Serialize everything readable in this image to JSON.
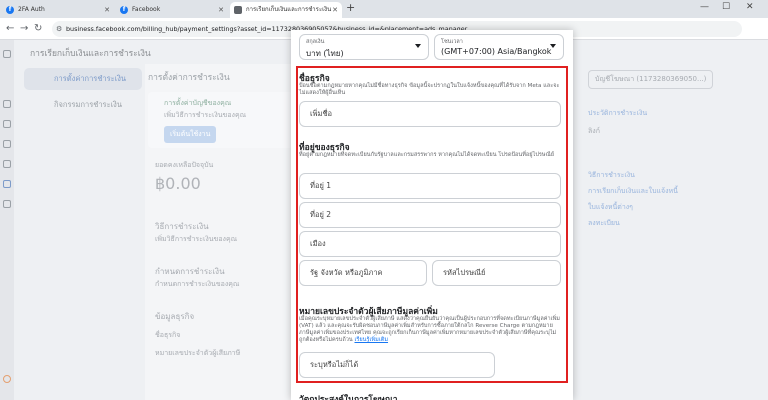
{
  "browser": {
    "tabs": [
      {
        "title": "2FA Auth",
        "active": false
      },
      {
        "title": "Facebook",
        "active": false
      },
      {
        "title": "การเรียกเก็บเงินและการชำระเงิน",
        "active": true
      }
    ],
    "url": "business.facebook.com/billing_hub/payment_settings?asset_id=117328036905057&business_id=&placement=ads_manager"
  },
  "background": {
    "page_title": "การเรียกเก็บเงินและการชำระเงิน",
    "nav": [
      "การตั้งค่าการชำระเงิน",
      "กิจกรรมการชำระเงิน"
    ],
    "main_title": "การตั้งค่าการชำระเงิน",
    "card1": [
      "การตั้งค่าบัญชีของคุณ",
      "เพิ่มวิธีการชำระเงินของคุณ",
      "เริ่มต้นใช้งาน"
    ],
    "balance_label": "ยอดคงเหลือปัจจุบัน",
    "balance_value": "฿0.00",
    "payment_methods": "วิธีการชำระเงิน",
    "payment_methods_sub": "เพิ่มวิธีการชำระเงินของคุณ",
    "limits": "กำหนดการชำระเงิน",
    "limits_sub": "กำหนดการชำระเงินของคุณ",
    "business_info": "ข้อมูลธุรกิจ",
    "business_name_row": "ชื่อธุรกิจ",
    "tax_row": "หมายเลขประจำตัวผู้เสียภาษี",
    "right_account": "บัญชีโฆษณา (1173280369050...)",
    "right_links": [
      "ประวัติการชำระเงิน",
      "ลิงก์",
      "วิธีการชำระเงิน",
      "การเรียกเก็บเงินและใบแจ้งหนี้",
      "ใบแจ้งหนี้ต่างๆ",
      "ลงทะเบียน"
    ]
  },
  "modal": {
    "currency": {
      "label": "สกุลเงิน",
      "value": "บาท (ไทย)"
    },
    "timezone": {
      "label": "โซนเวลา",
      "value": "(GMT+07:00) Asia/Bangkok"
    },
    "business_name": {
      "title": "ชื่อธุรกิจ",
      "desc": "ป้อนชื่อตามกฎหมายหากคุณไม่มีชื่อทางธุรกิจ ข้อมูลนี้จะปรากฏในใบแจ้งหนี้ของคุณที่ได้รับจาก Meta และจะไม่แสดงให้ผู้อื่นเห็น",
      "placeholder": "เพิ่มชื่อ"
    },
    "address": {
      "title": "ที่อยู่ของธุรกิจ",
      "desc": "ที่อยู่ตามกฎหมายที่จดทะเบียนกับรัฐบาลและกรมสรรพากร หากคุณไม่ได้จดทะเบียน โปรดป้อนที่อยู่ไปรษณีย์",
      "line1": "ที่อยู่ 1",
      "line2": "ที่อยู่ 2",
      "city": "เมือง",
      "state": "รัฐ จังหวัด หรือภูมิภาค",
      "zip": "รหัสไปรษณีย์"
    },
    "tax": {
      "title": "หมายเลขประจำตัวผู้เสียภาษีมูลค่าเพิ่ม",
      "desc": "เมื่อคุณระบุหมายเลขประจำตัวผู้เสียภาษี แสดงว่าคุณยืนยันว่าคุณเป็นผู้ประกอบการที่จดทะเบียนภาษีมูลค่าเพิ่ม (VAT) แล้ว และคุณจะรับผิดชอบภาษีมูลค่าเพิ่มสำหรับการซื้อภายใต้กลไก Reverse Charge ตามกฎหมายภาษีมูลค่าเพิ่มของประเทศไทย คุณจะถูกเรียกเก็บภาษีมูลค่าเพิ่มหากหมายเลขประจำตัวผู้เสียภาษีที่คุณระบุไม่ถูกต้องหรือไม่ครบถ้วน",
      "link": "เรียนรู้เพิ่มเติม",
      "placeholder": "ระบุหรือไม่ก็ได้"
    },
    "next_section": "วัตถุประสงค์ในการโฆษณา"
  }
}
